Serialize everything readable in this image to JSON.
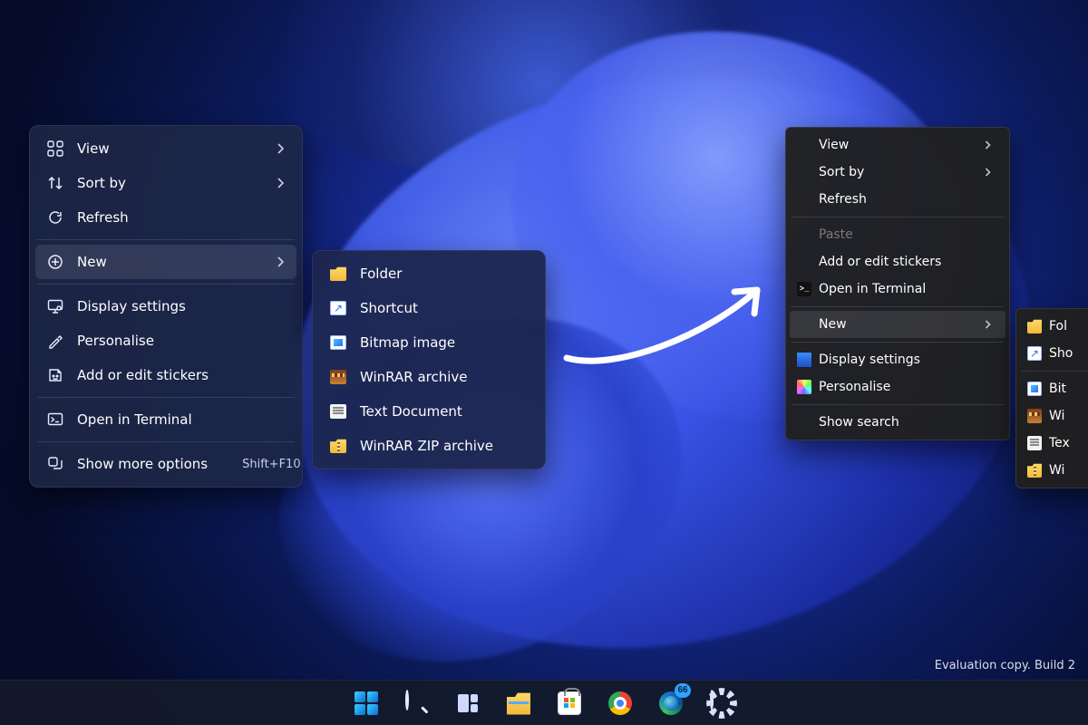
{
  "wallpaper": {
    "accent": "#2a4de0"
  },
  "menu11": {
    "view": "View",
    "sort": "Sort by",
    "refresh": "Refresh",
    "new": "New",
    "display": "Display settings",
    "personalise": "Personalise",
    "stickers": "Add or edit stickers",
    "terminal": "Open in Terminal",
    "more": "Show more options",
    "more_hint": "Shift+F10"
  },
  "submenu_new": [
    {
      "label": "Folder",
      "icon": "folder"
    },
    {
      "label": "Shortcut",
      "icon": "shortcut"
    },
    {
      "label": "Bitmap image",
      "icon": "bmp"
    },
    {
      "label": "WinRAR archive",
      "icon": "rar"
    },
    {
      "label": "Text Document",
      "icon": "txt"
    },
    {
      "label": "WinRAR ZIP archive",
      "icon": "zip"
    }
  ],
  "classic_menu": {
    "view": "View",
    "sort": "Sort by",
    "refresh": "Refresh",
    "paste": "Paste",
    "stickers": "Add or edit stickers",
    "terminal": "Open in Terminal",
    "new": "New",
    "display": "Display settings",
    "personalise": "Personalise",
    "show_search": "Show search"
  },
  "classic_sub": [
    {
      "label": "Fol",
      "icon": "folder"
    },
    {
      "label": "Sho",
      "icon": "shortcut"
    },
    {
      "label": "Bit",
      "icon": "bmp"
    },
    {
      "label": "Wi",
      "icon": "rar"
    },
    {
      "label": "Tex",
      "icon": "txt"
    },
    {
      "label": "Wi",
      "icon": "zip"
    }
  ],
  "taskbar": {
    "badge_edge": "66"
  },
  "watermark": "Evaluation copy. Build 2"
}
